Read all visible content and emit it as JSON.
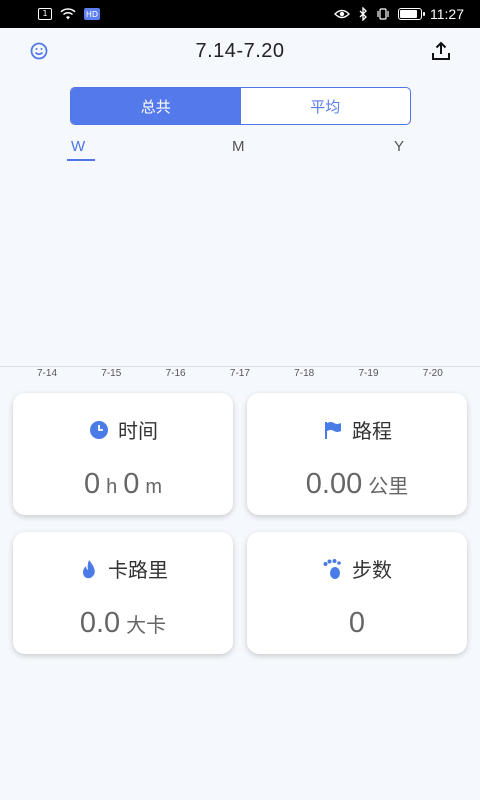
{
  "status_bar": {
    "badge": "1",
    "hd": "HD",
    "time": "11:27",
    "battery_level": 0.9
  },
  "header": {
    "title": "7.14-7.20",
    "left_icon": "smiley-face-icon",
    "right_icon": "share-upload-icon"
  },
  "segment": {
    "options": [
      "总共",
      "平均"
    ],
    "selected": "总共"
  },
  "period_tabs": {
    "items": [
      "W",
      "M",
      "Y"
    ],
    "selected": "W"
  },
  "chart_data": {
    "type": "bar",
    "categories": [
      "7-14",
      "7-15",
      "7-16",
      "7-17",
      "7-18",
      "7-19",
      "7-20"
    ],
    "values": [
      0,
      0,
      0,
      0,
      0,
      0,
      0
    ],
    "title": "",
    "xlabel": "",
    "ylabel": ""
  },
  "cards": {
    "time": {
      "label": "时间",
      "icon": "clock-icon",
      "h_value": "0",
      "h_unit": "h",
      "m_value": "0",
      "m_unit": "m"
    },
    "distance": {
      "label": "路程",
      "icon": "flag-icon",
      "value": "0.00",
      "unit": "公里"
    },
    "calories": {
      "label": "卡路里",
      "icon": "flame-icon",
      "value": "0.0",
      "unit": "大卡"
    },
    "steps": {
      "label": "步数",
      "icon": "footprint-icon",
      "value": "0"
    }
  },
  "colors": {
    "accent": "#5479ea",
    "background": "#f5f8fc"
  }
}
